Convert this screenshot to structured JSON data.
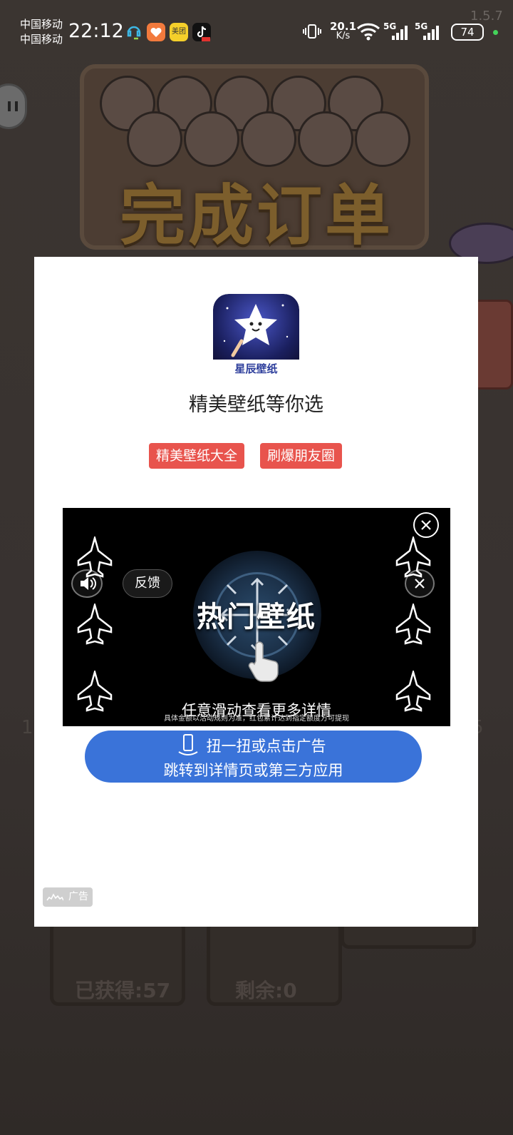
{
  "status_bar": {
    "carrier_1": "中国移动",
    "carrier_2": "中国移动",
    "time": "22:12",
    "notification_icons": [
      "support-icon",
      "heart-app-icon",
      "meituan-icon",
      "tiktok-icon"
    ],
    "meituan_label": "美团",
    "net_speed_value": "20.1",
    "net_speed_unit": "K/s",
    "signal_1": "5G",
    "signal_2": "5G",
    "battery": "74",
    "version": "1.5.7"
  },
  "background": {
    "title": "完成订单",
    "bin_left_label": "已获得:57",
    "bin_mid_label": "剩余:0",
    "edge_left": "1",
    "edge_right": "5"
  },
  "ad": {
    "app_name": "星辰壁纸",
    "headline": "精美壁纸等你选",
    "tags": [
      "精美壁纸大全",
      "刷爆朋友圈"
    ],
    "video": {
      "title": "热门壁纸",
      "subtitle": "任意滑动查看更多详情",
      "fine_print": "具体金额以活动规则为准，红包累计达到指定额度方可提现",
      "feedback_label": "反馈"
    },
    "cta_line_1": "扭一扭或点击广告",
    "cta_line_2": "跳转到详情页或第三方应用",
    "ad_label": "广告"
  },
  "colors": {
    "tag_red": "#e8544d",
    "cta_blue": "#3a73d9"
  }
}
